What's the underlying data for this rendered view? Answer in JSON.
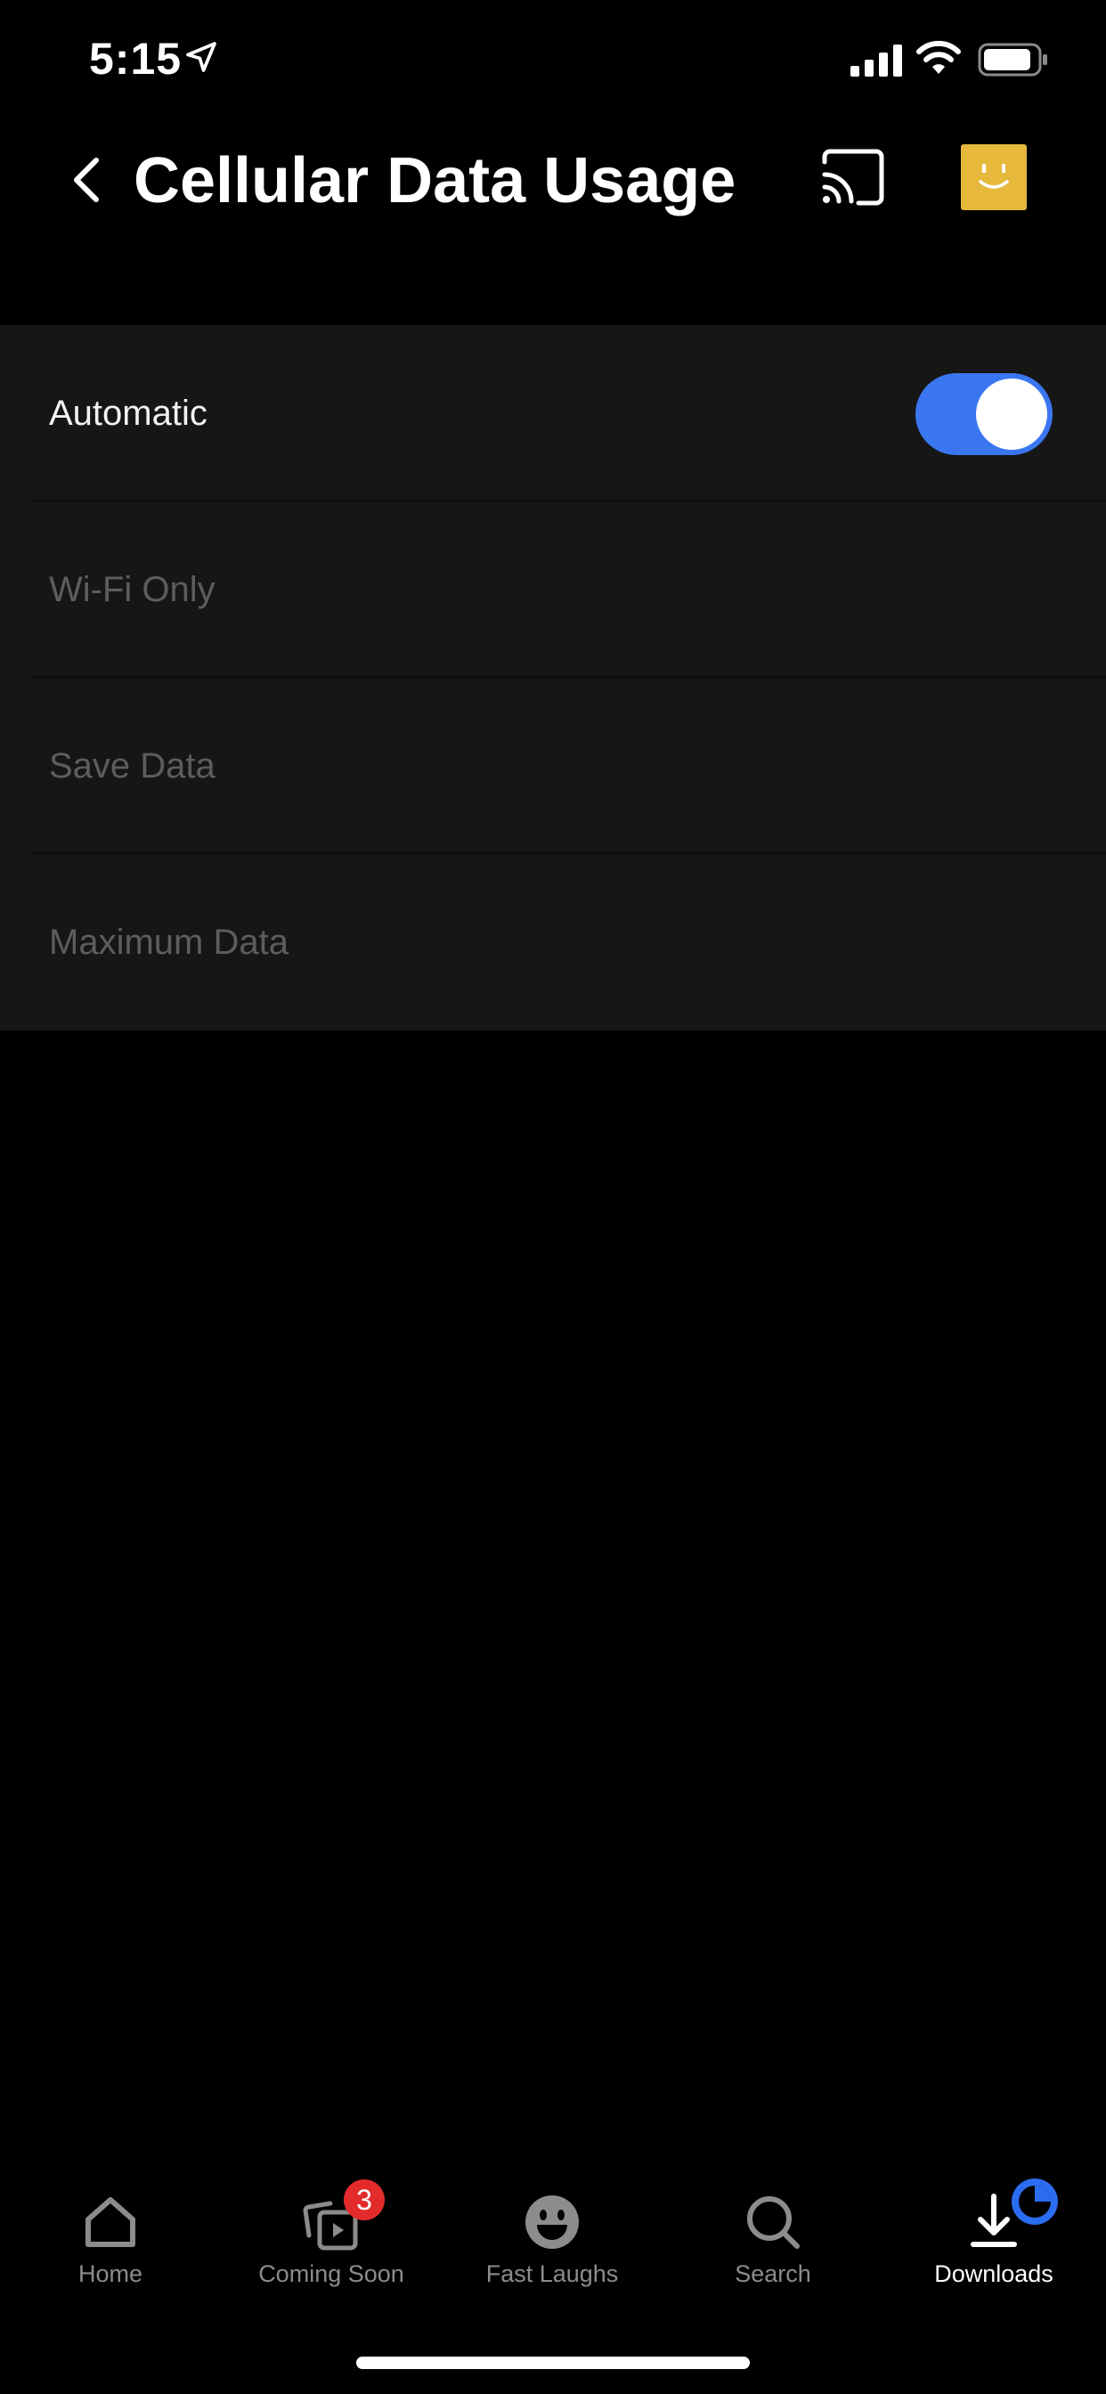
{
  "status_bar": {
    "time": "5:15",
    "icons": [
      "location-arrow-icon",
      "cellular-signal-icon",
      "wifi-icon",
      "battery-icon"
    ]
  },
  "header": {
    "title": "Cellular Data Usage",
    "back_icon": "chevron-left-icon",
    "cast_icon": "cast-icon",
    "avatar_icon": "profile-avatar"
  },
  "settings": {
    "rows": [
      {
        "label": "Automatic",
        "state": "active",
        "toggle_on": true
      },
      {
        "label": "Wi-Fi Only",
        "state": "disabled"
      },
      {
        "label": "Save Data",
        "state": "disabled"
      },
      {
        "label": "Maximum Data",
        "state": "disabled"
      }
    ]
  },
  "tab_bar": {
    "tabs": [
      {
        "label": "Home",
        "icon": "home-icon",
        "selected": false
      },
      {
        "label": "Coming Soon",
        "icon": "coming-soon-icon",
        "selected": false,
        "badge": "3"
      },
      {
        "label": "Fast Laughs",
        "icon": "laugh-icon",
        "selected": false
      },
      {
        "label": "Search",
        "icon": "search-icon",
        "selected": false
      },
      {
        "label": "Downloads",
        "icon": "download-icon",
        "selected": true
      }
    ]
  },
  "colors": {
    "background": "#000000",
    "list_background": "#161616",
    "toggle_on": "#3a76f0",
    "badge": "#e32b2b",
    "avatar": "#e6b93d",
    "disabled_text": "#5d5d5d"
  }
}
